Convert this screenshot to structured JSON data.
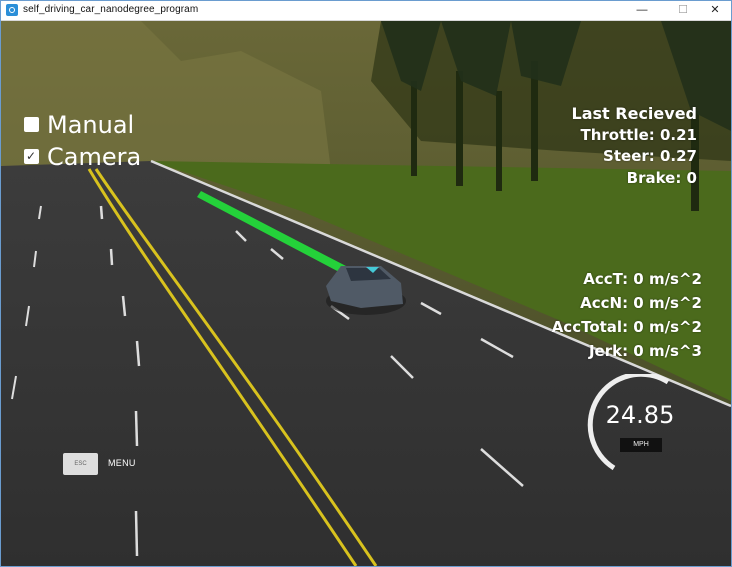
{
  "window": {
    "title": "self_driving_car_nanodegree_program",
    "minimize_symbol": "—",
    "maximize_symbol": "☐",
    "close_symbol": "✕"
  },
  "options": [
    {
      "label": "Manual",
      "checked": false,
      "check_symbol": ""
    },
    {
      "label": "Camera",
      "checked": true,
      "check_symbol": "✓"
    }
  ],
  "last_received": {
    "header": "Last Recieved",
    "throttle": "Throttle: 0.21",
    "steer": "Steer: 0.27",
    "brake": "Brake: 0"
  },
  "dynamics": {
    "acc_t": "AccT: 0 m/s^2",
    "acc_n": "AccN: 0 m/s^2",
    "acc_total": "AccTotal: 0 m/s^2",
    "jerk": "Jerk: 0 m/s^3"
  },
  "menu": {
    "esc_label": "ESC",
    "menu_label": "MENU"
  },
  "speedometer": {
    "value": "24.85",
    "unit": "MPH"
  }
}
